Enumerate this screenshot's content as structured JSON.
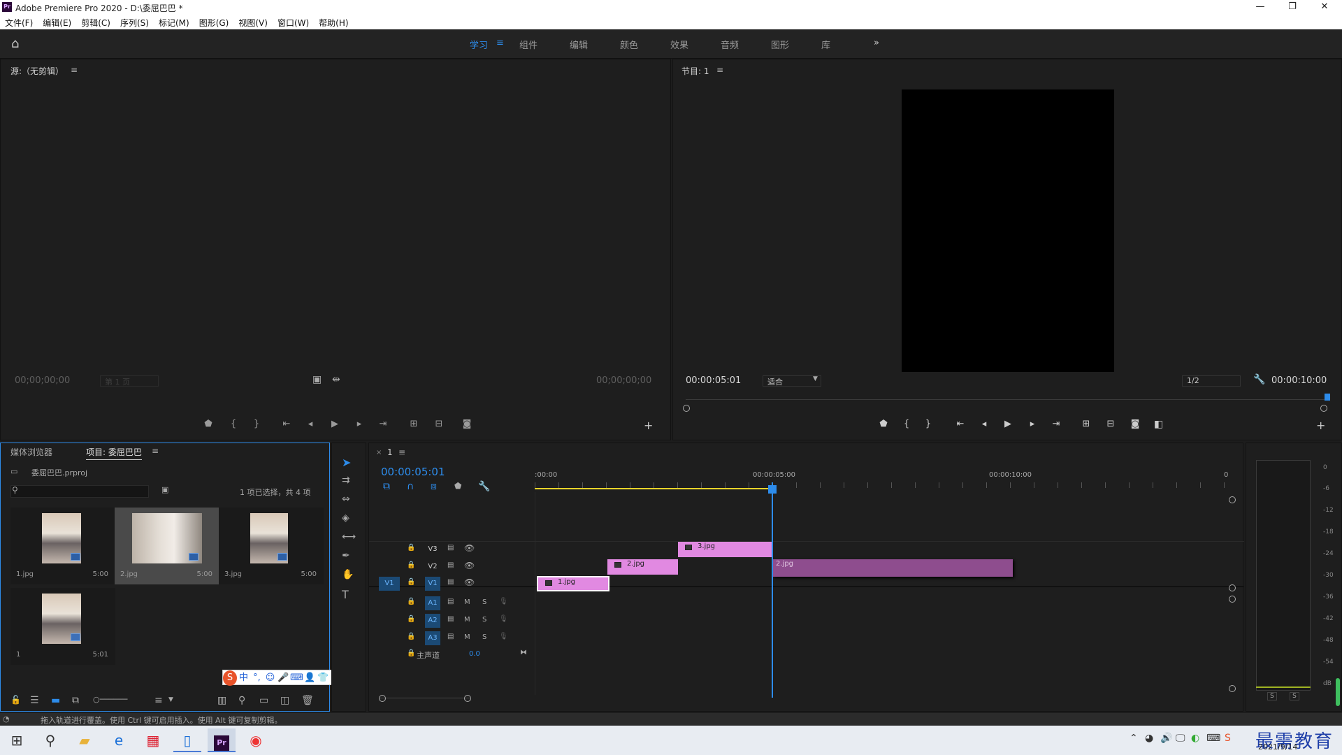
{
  "window": {
    "title": "Adobe Premiere Pro 2020 - D:\\委屈巴巴 *",
    "app_icon": "Pr"
  },
  "menu": [
    "文件(F)",
    "编辑(E)",
    "剪辑(C)",
    "序列(S)",
    "标记(M)",
    "图形(G)",
    "视图(V)",
    "窗口(W)",
    "帮助(H)"
  ],
  "workspaces": [
    "学习",
    "组件",
    "编辑",
    "颜色",
    "效果",
    "音频",
    "图形",
    "库"
  ],
  "workspace_active": "学习",
  "source": {
    "title": "源:（无剪辑）",
    "tc_left": "00;00;00;00",
    "page_select": "第 1 页",
    "tc_right": "00;00;00;00"
  },
  "program": {
    "title": "节目: 1",
    "tc_left": "00:00:05:01",
    "fit_select": "适合",
    "quality_select": "1/2",
    "tc_right": "00:00:10:00"
  },
  "project": {
    "tabs": [
      "媒体浏览器",
      "项目: 委屈巴巴"
    ],
    "active_tab": "项目: 委屈巴巴",
    "file_name": "委屈巴巴.prproj",
    "search_placeholder": "",
    "selection_status": "1 项已选择，共 4 项",
    "items": [
      {
        "name": "1.jpg",
        "duration": "5:00"
      },
      {
        "name": "2.jpg",
        "duration": "5:00"
      },
      {
        "name": "3.jpg",
        "duration": "5:00"
      },
      {
        "name": "1",
        "duration": "5:01"
      }
    ]
  },
  "timeline": {
    "tab_label": "1",
    "current_tc": "00:00:05:01",
    "ruler_labels": [
      ":00:00",
      "00:00:05:00",
      "00:00:10:00",
      "0"
    ],
    "video_tracks": [
      "V3",
      "V2",
      "V1"
    ],
    "audio_tracks": [
      "A1",
      "A2",
      "A3"
    ],
    "source_patch": "V1",
    "track_buttons": {
      "mute": "M",
      "solo": "S"
    },
    "master_label": "主声道",
    "master_value": "0.0",
    "clips": [
      {
        "track": "V1",
        "name": "1.jpg"
      },
      {
        "track": "V2",
        "name": "2.jpg"
      },
      {
        "track": "V3",
        "name": "3.jpg"
      },
      {
        "track": "V2",
        "name": "2.jpg"
      }
    ]
  },
  "audio_meter": {
    "labels": [
      "0",
      "-6",
      "-12",
      "-18",
      "-24",
      "-30",
      "-36",
      "-42",
      "-48",
      "-54",
      "dB"
    ],
    "solo_labels": [
      "S",
      "S"
    ]
  },
  "status_bar": "拖入轨道进行覆盖。使用 Ctrl 键可启用插入。使用 Alt 键可复制剪辑。",
  "watermark": "最需教育",
  "taskbar": {
    "date": "2021/9/14"
  }
}
